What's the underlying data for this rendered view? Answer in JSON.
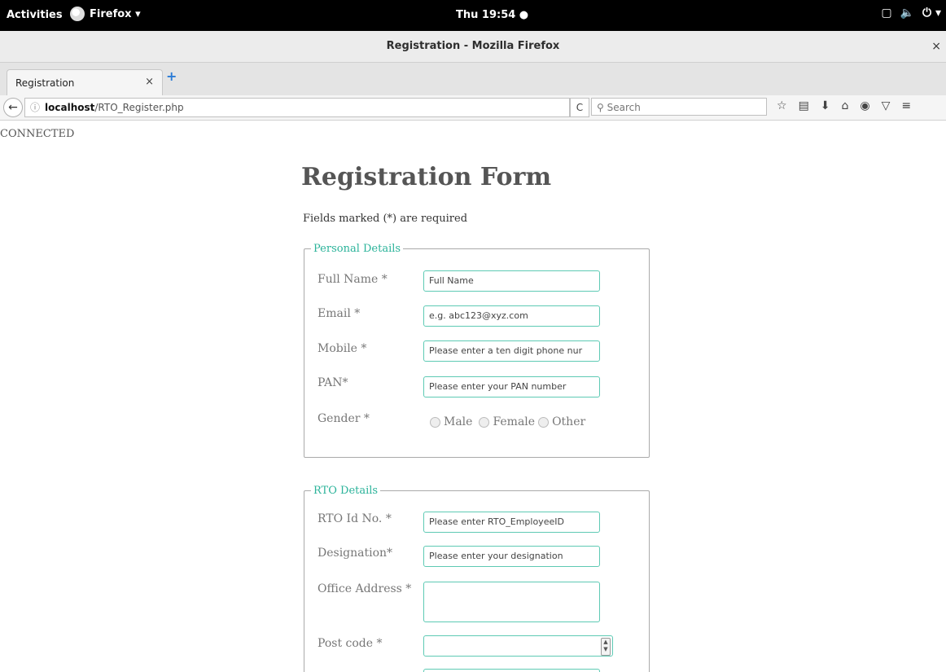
{
  "system_bar": {
    "activities": "Activities",
    "app_menu": "Firefox ▾",
    "clock": "Thu 19:54 ●",
    "tray_icons": [
      "window-icon",
      "volume-icon",
      "power-icon"
    ]
  },
  "window": {
    "title": "Registration - Mozilla Firefox",
    "close": "×"
  },
  "tabs": [
    {
      "label": "Registration",
      "close": "×"
    }
  ],
  "new_tab": "+",
  "navbar": {
    "back": "←",
    "url_host": "localhost",
    "url_path": "/RTO_Register.php",
    "reload": "C",
    "search_placeholder": "Search"
  },
  "page": {
    "status": "CONNECTED",
    "title": "Registration Form",
    "required_note": "Fields marked (*) are required",
    "personal": {
      "legend": "Personal Details",
      "full_name_label": "Full Name *",
      "full_name_placeholder": "Full Name",
      "email_label": "Email *",
      "email_placeholder": "e.g. abc123@xyz.com",
      "mobile_label": "Mobile *",
      "mobile_placeholder": "Please enter a ten digit phone nur",
      "pan_label": "PAN*",
      "pan_placeholder": "Please enter your PAN number",
      "gender_label": "Gender *",
      "gender_options": [
        "Male",
        "Female",
        "Other"
      ]
    },
    "rto": {
      "legend": "RTO Details",
      "rto_id_label": "RTO Id No. *",
      "rto_id_placeholder": "Please enter RTO_EmployeeID",
      "designation_label": "Designation*",
      "designation_placeholder": "Please enter your designation",
      "office_address_label": "Office Address *",
      "post_code_label": "Post code *"
    }
  }
}
